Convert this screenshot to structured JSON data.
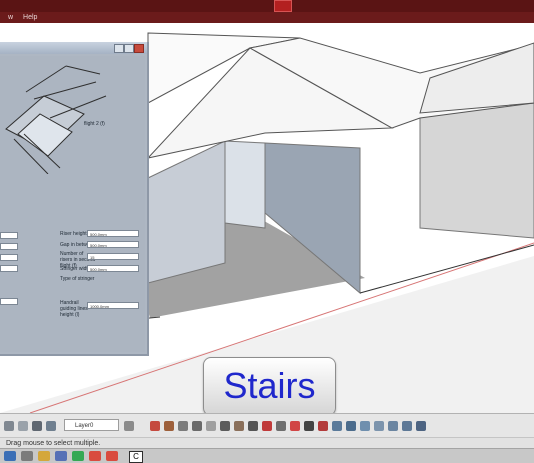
{
  "menu": {
    "item": "Help"
  },
  "dialog": {
    "preview_label": "flight 2 (f)",
    "fields": [
      {
        "label": "Riser height (b)",
        "value": "500.0mm"
      },
      {
        "label": "Gap in between (d)",
        "value": "500.0mm"
      },
      {
        "label": "Number of risers in second flight (f)",
        "value": "15"
      },
      {
        "label": "Stringer width (h)",
        "value": "500.0mm"
      },
      {
        "label": "Type of stringer",
        "value": ""
      },
      {
        "label": "Handrail guiding lines height (l)",
        "value": "1000.0mm"
      }
    ]
  },
  "title_button": {
    "label": "Stairs"
  },
  "toolbar": {
    "layer": "Layer0"
  },
  "status": {
    "text": "Drag mouse to select multiple."
  },
  "taskbar": {
    "cad_label": "C"
  }
}
